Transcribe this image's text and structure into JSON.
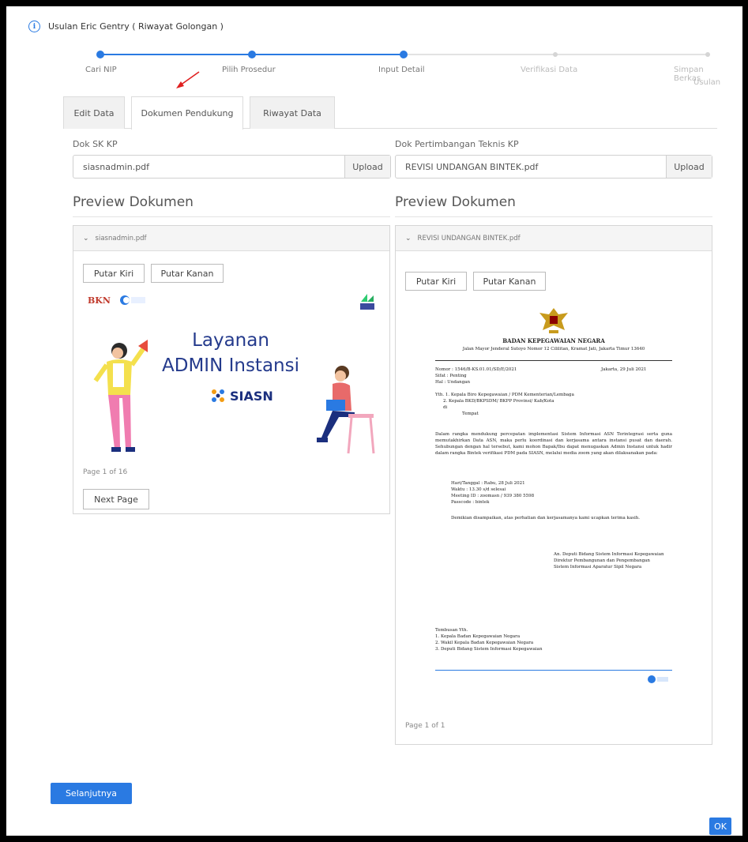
{
  "dialog": {
    "title": "Usulan Eric Gentry ( Riwayat Golongan )"
  },
  "stepper": {
    "steps": [
      "Cari NIP",
      "Pilih Prosedur",
      "Input Detail",
      "Verifikasi Data",
      "Simpan Berkas",
      "Usulan"
    ],
    "active_index": 2
  },
  "tabs": [
    "Edit Data",
    "Dokumen Pendukung",
    "Riwayat Data"
  ],
  "active_tab": 1,
  "left": {
    "label": "Dok SK KP",
    "file": "siasnadmin.pdf",
    "upload": "Upload",
    "preview_title": "Preview Dokumen",
    "panel_title": "siasnadmin.pdf",
    "rotate_left": "Putar Kiri",
    "rotate_right": "Putar Kanan",
    "slide_line1": "Layanan",
    "slide_line2": "ADMIN Instansi",
    "slide_logo1": "BKN",
    "slide_logo2": "SIASN",
    "page_text": "Page 1 of 16",
    "next_page": "Next Page"
  },
  "right": {
    "label": "Dok Pertimbangan Teknis KP",
    "file": "REVISI UNDANGAN BINTEK.pdf",
    "upload": "Upload",
    "preview_title": "Preview Dokumen",
    "panel_title": "REVISI UNDANGAN BINTEK.pdf",
    "rotate_left": "Putar Kiri",
    "rotate_right": "Putar Kanan",
    "doc_heading": "BADAN KEPEGAWAIAN NEGARA",
    "doc_address": "Jalan Mayor Jenderal Sutoyo Nomor 12 Cililitan, Kramat Jati, Jakarta Timur 13640",
    "doc_date": "Jakarta, 29 Juli 2021",
    "doc_meta": [
      "Nomor : 1546/B-KS.01.01/SD/E/2021",
      "Sifat : Penting",
      "Hal : Undangan"
    ],
    "doc_to": [
      "Yth. 1. Kepala Biro Kepegawaian / PDM Kementerian/Lembaga",
      "2. Kepala BKD/BKPSDM/ BKPP Provinsi/ Kab/Kota",
      "di",
      "Tempat"
    ],
    "doc_body": "Dalam rangka mendukung percepatan implementasi Sistem Informasi ASN Terintegrasi serta guna memutakhirkan Data ASN, maka perlu koordinasi dan kerjasama antara instansi pusat dan daerah. Sehubungan dengan hal tersebut, kami mohon Bapak/Ibu dapat menugaskan Admin Instansi untuk hadir dalam rangka Bintek verifikasi PDM pada SIASN, melalui media zoom yang akan dilaksanakan pada:",
    "doc_schedule": [
      "Hari/Tanggal : Rabu, 28 Juli 2021",
      "Waktu : 13.30 s/d selesai",
      "Meeting ID : zoomasn / 939 380 5598",
      "Passcode : bintek"
    ],
    "doc_closing": "Demikian disampaikan, atas perhatian dan kerjasamanya kami ucapkan terima kasih.",
    "doc_sign": [
      "An. Deputi Bidang Sistem Informasi Kepegawaian",
      "Direktur Pembangunan dan Pengembangan",
      "Sistem Informasi Aparatur Sipil Negara"
    ],
    "doc_cc_title": "Tembusan Yth.",
    "doc_cc": [
      "1. Kepala Badan Kepegawaian Negara",
      "2. Wakil Kepala Badan Kepegawaian Negara",
      "3. Deputi Bidang Sistem Informasi Kepegawaian"
    ],
    "page_text": "Page 1 of 1"
  },
  "footer": {
    "next": "Selanjutnya",
    "ok": "OK"
  },
  "colors": {
    "accent": "#2a7ae2",
    "arrow": "#e02020"
  }
}
